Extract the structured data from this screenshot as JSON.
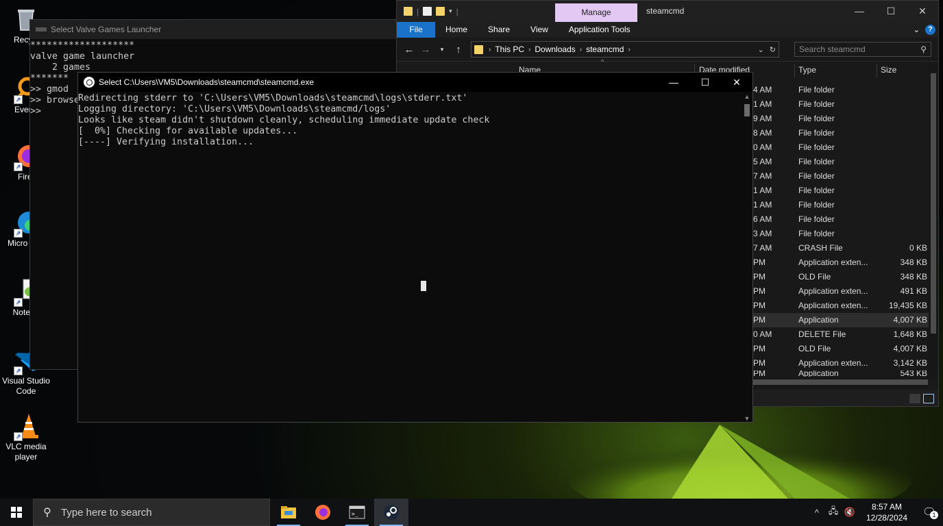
{
  "desktop": {
    "icons": [
      {
        "label": "Recycl",
        "icon": "recycle-bin-icon"
      },
      {
        "label": "Everyt",
        "icon": "everything-search-icon"
      },
      {
        "label": "Firef",
        "icon": "firefox-icon"
      },
      {
        "label": "Micro Edg",
        "icon": "edge-icon"
      },
      {
        "label": "Notepa",
        "icon": "notepad-plus-plus-icon"
      },
      {
        "label": "Visual Studio Code",
        "icon": "vscode-icon"
      },
      {
        "label": "VLC media player",
        "icon": "vlc-icon"
      }
    ]
  },
  "launcher": {
    "title": "Select Valve Games Launcher",
    "lines": "*******************\nvalve game launcher\n    2 games\n*******\n>> gmod\n>> browse\n>>"
  },
  "explorer": {
    "manage_tab": "Manage",
    "title": "steamcmd",
    "ribbon": [
      "File",
      "Home",
      "Share",
      "View",
      "Application Tools"
    ],
    "breadcrumb": [
      "This PC",
      "Downloads",
      "steamcmd"
    ],
    "search_placeholder": "Search steamcmd",
    "columns": {
      "name": "Name",
      "date": "Date modified",
      "type": "Type",
      "size": "Size"
    },
    "rows": [
      {
        "date": "4 AM",
        "type": "File folder",
        "size": ""
      },
      {
        "date": "1 AM",
        "type": "File folder",
        "size": ""
      },
      {
        "date": "9 AM",
        "type": "File folder",
        "size": ""
      },
      {
        "date": "8 AM",
        "type": "File folder",
        "size": ""
      },
      {
        "date": "0 AM",
        "type": "File folder",
        "size": ""
      },
      {
        "date": "5 AM",
        "type": "File folder",
        "size": ""
      },
      {
        "date": "7 AM",
        "type": "File folder",
        "size": ""
      },
      {
        "date": "1 AM",
        "type": "File folder",
        "size": ""
      },
      {
        "date": "1 AM",
        "type": "File folder",
        "size": ""
      },
      {
        "date": "6 AM",
        "type": "File folder",
        "size": ""
      },
      {
        "date": "3 AM",
        "type": "File folder",
        "size": ""
      },
      {
        "date": "7 AM",
        "type": "CRASH File",
        "size": "0 KB"
      },
      {
        "date": "PM",
        "type": "Application exten...",
        "size": "348 KB"
      },
      {
        "date": "PM",
        "type": "OLD File",
        "size": "348 KB"
      },
      {
        "date": "PM",
        "type": "Application exten...",
        "size": "491 KB"
      },
      {
        "date": "PM",
        "type": "Application exten...",
        "size": "19,435 KB"
      },
      {
        "date": "PM",
        "type": "Application",
        "size": "4,007 KB",
        "selected": true
      },
      {
        "date": "0 AM",
        "type": "DELETE File",
        "size": "1,648 KB"
      },
      {
        "date": "PM",
        "type": "OLD File",
        "size": "4,007 KB"
      },
      {
        "date": "PM",
        "type": "Application exten...",
        "size": "3,142 KB"
      },
      {
        "date": "PM",
        "type": "Application",
        "size": "543 KB"
      }
    ]
  },
  "steamcmd": {
    "title": "Select C:\\Users\\VM5\\Downloads\\steamcmd\\steamcmd.exe",
    "output": "Redirecting stderr to 'C:\\Users\\VM5\\Downloads\\steamcmd\\logs\\stderr.txt'\nLogging directory: 'C:\\Users\\VM5\\Downloads\\steamcmd/logs'\nLooks like steam didn't shutdown cleanly, scheduling immediate update check\n[  0%] Checking for available updates...\n[----] Verifying installation..."
  },
  "taskbar": {
    "search_placeholder": "Type here to search",
    "apps": [
      "file-explorer-icon",
      "firefox-icon",
      "terminal-icon",
      "steam-icon"
    ],
    "time": "8:57 AM",
    "date": "12/28/2024",
    "notification_count": "1"
  },
  "colors": {
    "accent": "#1a73c9",
    "manage_tab": "#e3c8f3",
    "console_bg": "#0c0c0c",
    "taskbar_bg": "#101113"
  }
}
